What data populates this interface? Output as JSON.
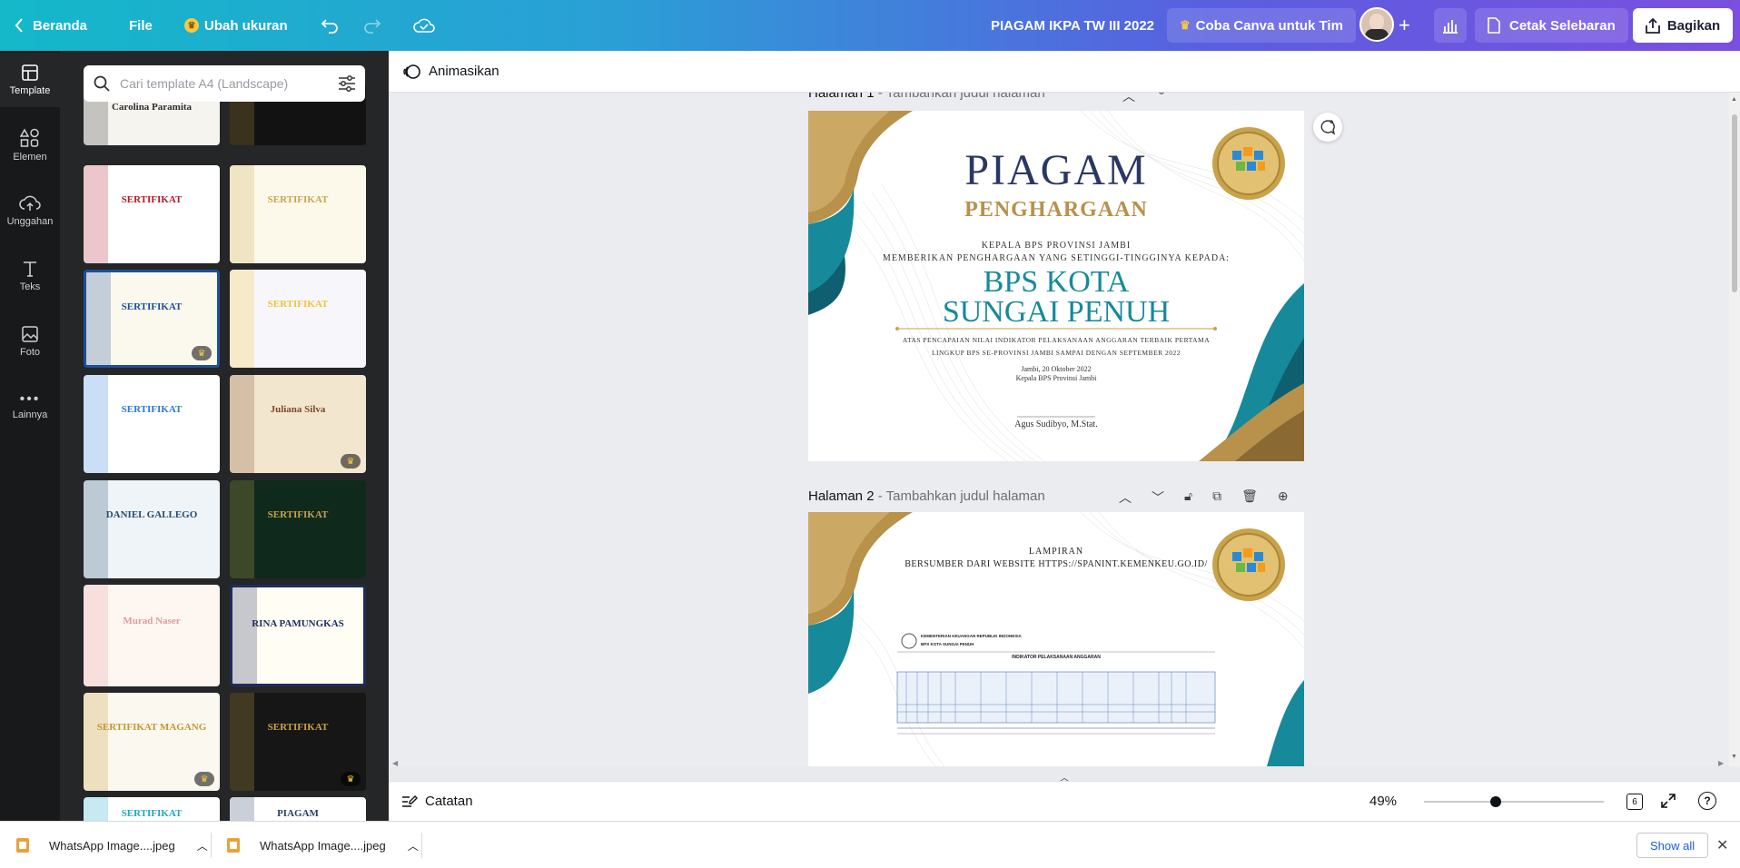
{
  "topbar": {
    "home_label": "Beranda",
    "file_label": "File",
    "resize_label": "Ubah ukuran",
    "doc_title": "PIAGAM IKPA TW III 2022",
    "try_teams_label": "Coba Canva untuk Tim",
    "print_label": "Cetak Selebaran",
    "share_label": "Bagikan"
  },
  "rail": {
    "items": [
      {
        "label": "Template",
        "icon": "template-icon"
      },
      {
        "label": "Elemen",
        "icon": "shapes-icon"
      },
      {
        "label": "Unggahan",
        "icon": "cloud-upload-icon"
      },
      {
        "label": "Teks",
        "icon": "text-icon"
      },
      {
        "label": "Foto",
        "icon": "photo-icon"
      },
      {
        "label": "Lainnya",
        "icon": "more-icon"
      }
    ]
  },
  "panel": {
    "search_placeholder": "Cari template A4 (Landscape)",
    "templates": [
      {
        "title": "Carolina Paramita",
        "bg": "#f6f4ef",
        "accent": "#2f2f2f"
      },
      {
        "title": "",
        "bg": "#121212",
        "accent": "#b8943e"
      },
      {
        "title": "SERTIFIKAT",
        "bg": "#ffffff",
        "accent": "#b11c2a"
      },
      {
        "title": "SERTIFIKAT",
        "bg": "#fcf9ea",
        "accent": "#c6a655"
      },
      {
        "title": "SERTIFIKAT",
        "bg": "#fbf8ee",
        "accent": "#1d4f9a"
      },
      {
        "title": "SERTIFIKAT",
        "bg": "#f7f7fb",
        "accent": "#f2c23a"
      },
      {
        "title": "SERTIFIKAT",
        "bg": "#ffffff",
        "accent": "#2a7ad6"
      },
      {
        "title": "Juliana Silva",
        "bg": "#f3e6cf",
        "accent": "#7d4a2a"
      },
      {
        "title": "DANIEL GALLEGO",
        "bg": "#eef4f8",
        "accent": "#274b6b"
      },
      {
        "title": "SERTIFIKAT",
        "bg": "#0f2a1d",
        "accent": "#c9a24a"
      },
      {
        "title": "Murad Naser",
        "bg": "#fdf6f1",
        "accent": "#e29aa0"
      },
      {
        "title": "RINA PAMUNGKAS",
        "bg": "#fffdf4",
        "accent": "#1f2d5a"
      },
      {
        "title": "SERTIFIKAT MAGANG",
        "bg": "#fbf8f0",
        "accent": "#c8952f"
      },
      {
        "title": "SERTIFIKAT",
        "bg": "#161616",
        "accent": "#c9a24a"
      },
      {
        "title": "SERTIFIKAT",
        "bg": "#ffffff",
        "accent": "#1fa6c8"
      },
      {
        "title": "PIAGAM",
        "bg": "#ffffff",
        "accent": "#2c3f63"
      }
    ]
  },
  "toolbar": {
    "animate_label": "Animasikan"
  },
  "pages": [
    {
      "label": "Halaman 1",
      "sublabel": " - Tambahkan judul halaman",
      "cert": {
        "title": "PIAGAM",
        "subtitle": "PENGHARGAAN",
        "line1": "KEPALA BPS PROVINSI JAMBI",
        "line2": "MEMBERIKAN PENGHARGAAN YANG SETINGGI-TINGGINYA KEPADA:",
        "recipient1": "BPS KOTA",
        "recipient2": "SUNGAI PENUH",
        "desc1": "ATAS PENCAPAIAN NILAI INDIKATOR PELAKSANAAN ANGGARAN TERBAIK PERTAMA",
        "desc2": "LINGKUP BPS SE-PROVINSI JAMBI SAMPAI DENGAN SEPTEMBER 2022",
        "date": "Jambi, 20 Oktober 2022",
        "signer_title": "Kepala BPS Provinsi Jambi",
        "signer_name": "Agus Sudibyo, M.Stat."
      }
    },
    {
      "label": "Halaman 2",
      "sublabel": " - Tambahkan judul halaman",
      "appendix": {
        "line1": "LAMPIRAN",
        "line2": "BERSUMBER DARI WEBSITE HTTPS://SPANINT.KEMENKEU.GO.ID/",
        "ministry": "KEMENTERIAN KEUANGAN REPUBLIK INDONESIA",
        "unit": "BPS KOTA SUNGAI PENUH",
        "table_title": "INDIKATOR PELAKSANAAN ANGGARAN"
      }
    }
  ],
  "bottom": {
    "notes_label": "Catatan",
    "zoom": "49%",
    "zoom_fraction": 0.4,
    "page_count": "6"
  },
  "downloads": {
    "items": [
      {
        "name": "WhatsApp Image....jpeg"
      },
      {
        "name": "WhatsApp Image....jpeg"
      }
    ],
    "show_all_label": "Show all"
  },
  "colors": {
    "teal": "#168a9a",
    "navy": "#2b3763",
    "gold": "#b8914a"
  }
}
